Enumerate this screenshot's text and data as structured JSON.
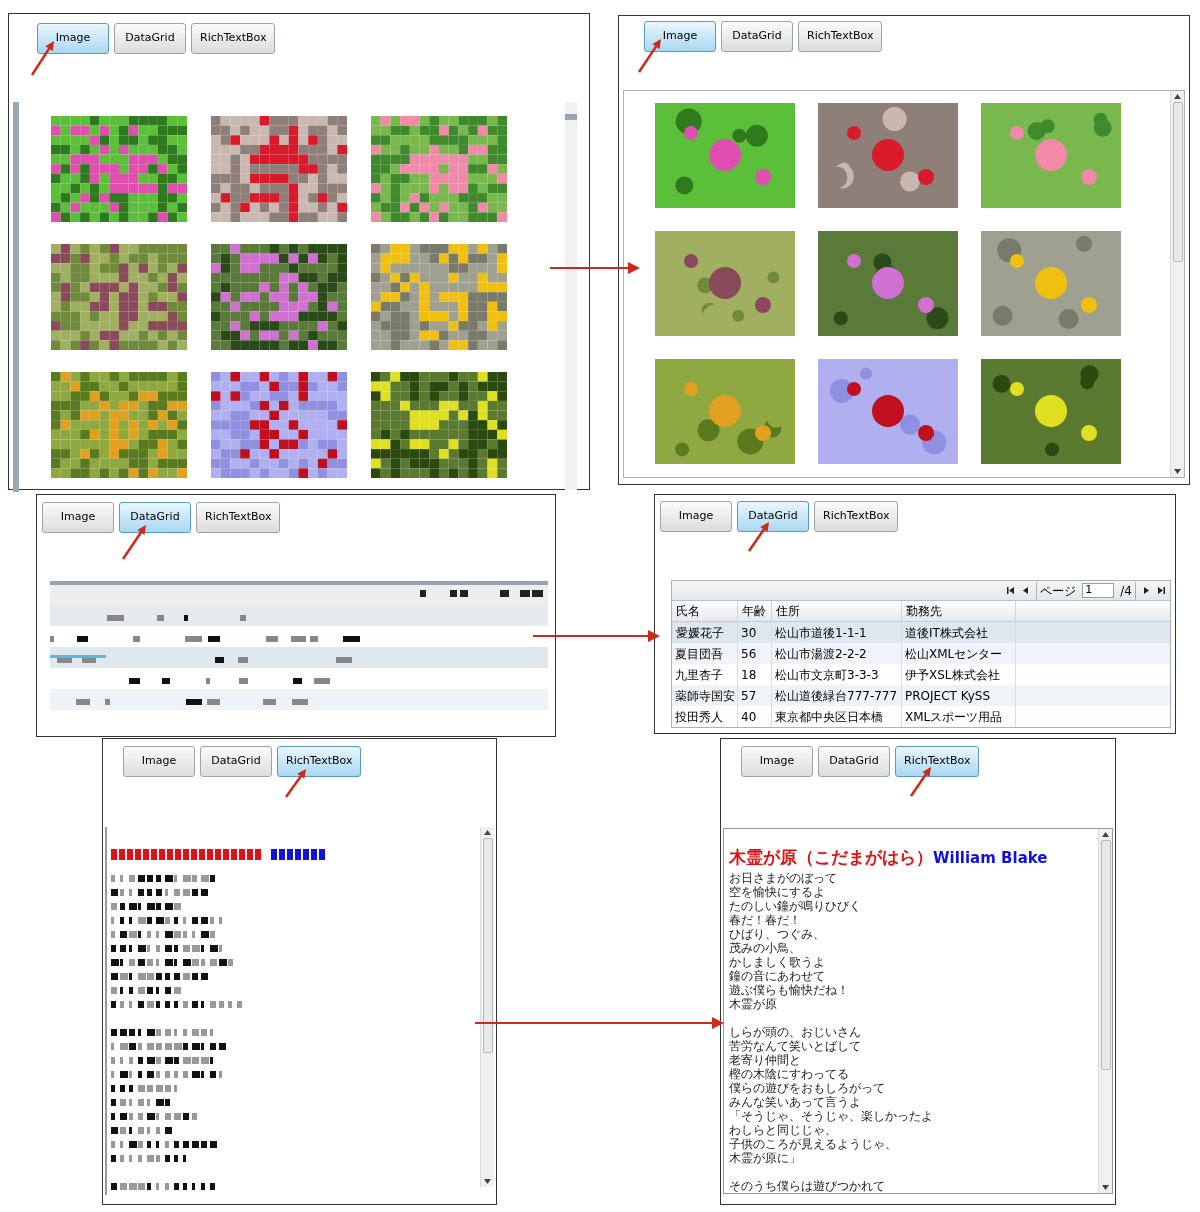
{
  "rows": [
    {
      "kind": "image",
      "before": {
        "tabs": [
          {
            "label": "Image",
            "selected": true
          },
          {
            "label": "DataGrid",
            "selected": false
          },
          {
            "label": "RichTextBox",
            "selected": false
          }
        ]
      },
      "after": {
        "tabs": [
          {
            "label": "Image",
            "selected": true
          },
          {
            "label": "DataGrid",
            "selected": false
          },
          {
            "label": "RichTextBox",
            "selected": false
          }
        ]
      }
    },
    {
      "kind": "datagrid",
      "before": {
        "tabs": [
          {
            "label": "Image",
            "selected": false
          },
          {
            "label": "DataGrid",
            "selected": true
          },
          {
            "label": "RichTextBox",
            "selected": false
          }
        ]
      },
      "after": {
        "tabs": [
          {
            "label": "Image",
            "selected": false
          },
          {
            "label": "DataGrid",
            "selected": true
          },
          {
            "label": "RichTextBox",
            "selected": false
          }
        ],
        "pager": {
          "label": "ページ",
          "value": "1",
          "total": "/4"
        },
        "columns": [
          "氏名",
          "年齢",
          "住所",
          "勤務先"
        ],
        "rows": [
          {
            "cells": [
              "愛媛花子",
              "30",
              "松山市道後1-1-1",
              "道後IT株式会社"
            ],
            "selected": true
          },
          {
            "cells": [
              "夏目団吾",
              "56",
              "松山市湯渡2-2-2",
              "松山XMLセンター"
            ],
            "selected": false
          },
          {
            "cells": [
              "九里杏子",
              "18",
              "松山市文京町3-3-3",
              "伊予XSL株式会社"
            ],
            "selected": false
          },
          {
            "cells": [
              "薬師寺国安",
              "57",
              "松山道後緑台777-777",
              "PROJECT KySS"
            ],
            "selected": false
          },
          {
            "cells": [
              "投田秀人",
              "40",
              "東京都中央区日本橋",
              "XMLスポーツ用品"
            ],
            "selected": false
          }
        ]
      }
    },
    {
      "kind": "richtext",
      "before": {
        "tabs": [
          {
            "label": "Image",
            "selected": false
          },
          {
            "label": "DataGrid",
            "selected": false
          },
          {
            "label": "RichTextBox",
            "selected": true
          }
        ]
      },
      "after": {
        "tabs": [
          {
            "label": "Image",
            "selected": false
          },
          {
            "label": "DataGrid",
            "selected": false
          },
          {
            "label": "RichTextBox",
            "selected": true
          }
        ],
        "title": "木霊が原（こだまがはら）",
        "author": "William Blake",
        "stanzas": [
          [
            "お日さまがのぼって",
            "空を愉快にするよ",
            "たのしい鐘が鳴りひびく",
            "春だ！春だ！",
            "ひばり、つぐみ、",
            "茂みの小鳥、",
            "かしましく歌うよ",
            "鐘の音にあわせて",
            "遊ぶ僕らも愉快だね！",
            "木霊が原"
          ],
          [
            "しらが頭の、おじいさん",
            "苦労なんて笑いとばして",
            "老寄り仲間と",
            "樫の木陰にすわってる",
            "僕らの遊びをおもしろがって",
            "みんな笑いあって言うよ",
            "「そうじゃ、そうじゃ、楽しかったよ",
            "わしらと同じじゃ、",
            "子供のころが見えるようじゃ、",
            "木霊が原に」"
          ],
          [
            "そのうち僕らは遊びつかれて"
          ]
        ]
      }
    }
  ]
}
